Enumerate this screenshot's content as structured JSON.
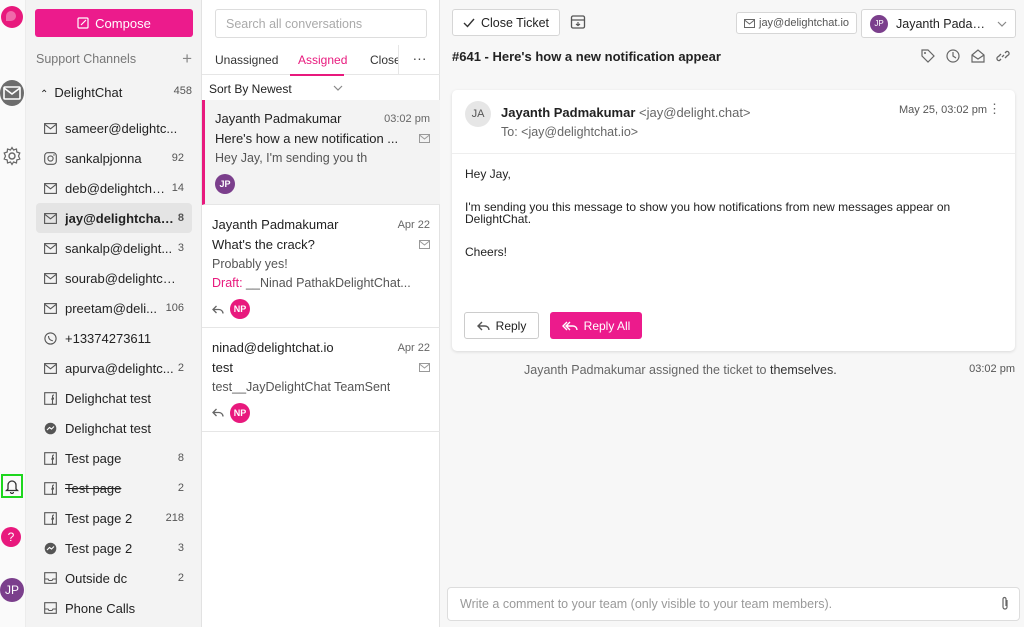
{
  "rail": {
    "avatar_initials": "JP"
  },
  "channels": {
    "compose_label": "Compose",
    "section_title": "Support Channels",
    "group": {
      "name": "DelightChat",
      "count": "458"
    },
    "items": [
      {
        "icon": "mail-icon",
        "name": "sameer@delightc...",
        "count": ""
      },
      {
        "icon": "instagram-icon",
        "name": "sankalpjonna",
        "count": "92"
      },
      {
        "icon": "mail-icon",
        "name": "deb@delightcha...",
        "count": "14"
      },
      {
        "icon": "mail-icon",
        "name": "jay@delightchat.io",
        "count": "8"
      },
      {
        "icon": "mail-icon",
        "name": "sankalp@delight...",
        "count": "3"
      },
      {
        "icon": "mail-icon",
        "name": "sourab@delightch...",
        "count": ""
      },
      {
        "icon": "mail-icon",
        "name": "preetam@deli...",
        "count": "106"
      },
      {
        "icon": "whatsapp-icon",
        "name": "+13374273611",
        "count": ""
      },
      {
        "icon": "mail-icon",
        "name": "apurva@delightc...",
        "count": "2"
      },
      {
        "icon": "facebook-icon",
        "name": "Delighchat test",
        "count": ""
      },
      {
        "icon": "messenger-icon",
        "name": "Delighchat test",
        "count": ""
      },
      {
        "icon": "facebook-icon",
        "name": "Test page",
        "count": "8"
      },
      {
        "icon": "facebook-icon",
        "name": "Test page",
        "count": "2"
      },
      {
        "icon": "facebook-icon",
        "name": "Test page 2",
        "count": "218"
      },
      {
        "icon": "messenger-icon",
        "name": "Test page 2",
        "count": "3"
      },
      {
        "icon": "inbox-icon",
        "name": "Outside dc",
        "count": "2"
      },
      {
        "icon": "inbox-icon",
        "name": "Phone Calls",
        "count": ""
      }
    ]
  },
  "conversations": {
    "search_placeholder": "Search all conversations",
    "tabs": [
      "Unassigned",
      "Assigned",
      "Closed"
    ],
    "more_label": "···",
    "sort_label": "Sort By Newest",
    "threads": [
      {
        "name": "Jayanth Padmakumar",
        "date": "03:02 pm",
        "subject": "Here's how a new notification ...",
        "preview": "Hey Jay, I'm sending you th",
        "draft_label": "",
        "draft_text": "",
        "badge": "JP",
        "badge_color": "#7b3f8c"
      },
      {
        "name": "Jayanth Padmakumar",
        "date": "Apr 22",
        "subject": "What's the crack?",
        "preview": "Probably yes!",
        "draft_label": "Draft:",
        "draft_text": " __Ninad PathakDelightChat...",
        "badge": "NP",
        "badge_color": "#e8197d"
      },
      {
        "name": "ninad@delightchat.io",
        "date": "Apr 22",
        "subject": "test",
        "preview": "test__JayDelightChat TeamSent",
        "draft_label": "",
        "draft_text": "",
        "badge": "NP",
        "badge_color": "#e8197d"
      }
    ]
  },
  "ticket": {
    "close_label": "Close Ticket",
    "email_chip": "jay@delightchat.io",
    "assignee_initials": "JP",
    "assignee_name": "Jayanth Padam...",
    "title": "#641 - Here's how a new notification appear",
    "message": {
      "avatar": "JA",
      "from_name": "Jayanth Padmakumar",
      "from_email": "<jay@delight.chat>",
      "to": "To: <jay@delightchat.io>",
      "date": "May 25, 03:02 pm",
      "body": [
        "Hey Jay,",
        "I'm sending you this message to show you how notifications from new messages appear on DelightChat.",
        "Cheers!"
      ],
      "reply_label": "Reply",
      "reply_all_label": "Reply All"
    },
    "activity": {
      "text": "Jayanth Padmakumar assigned the ticket to",
      "target": "themselves.",
      "time": "03:02 pm"
    },
    "comment_placeholder": "Write a comment to your team (only visible to your team members)."
  },
  "colors": {
    "accent": "#e8197d",
    "highlight": "#1ed61e"
  }
}
